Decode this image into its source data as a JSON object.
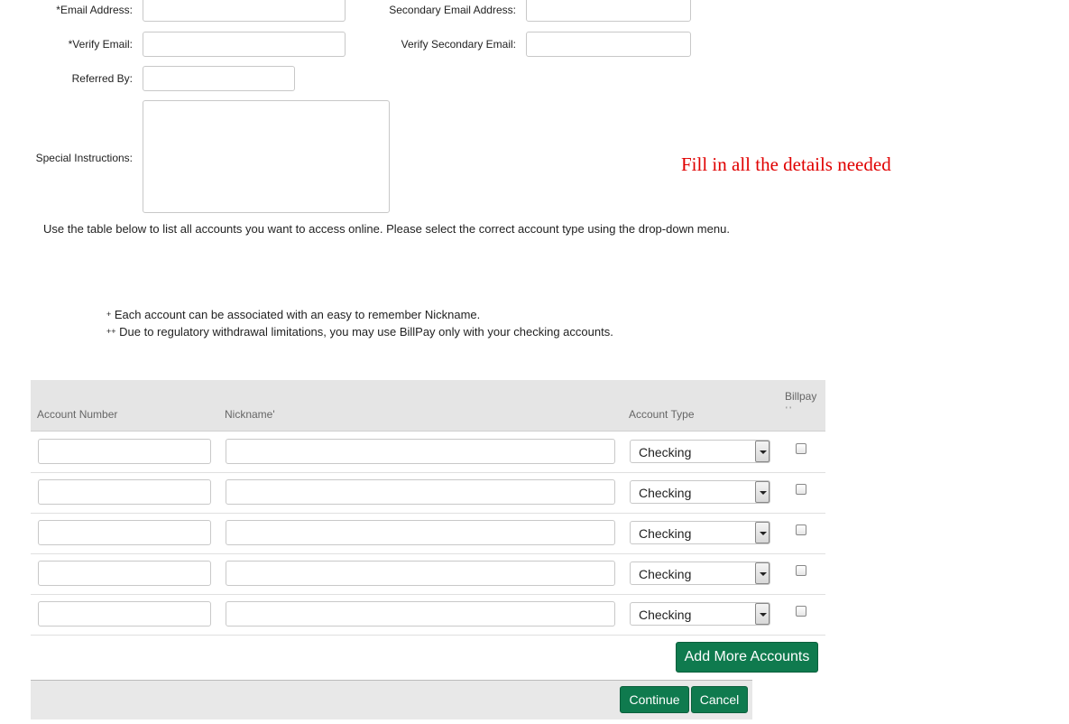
{
  "form": {
    "email_label": "*Email Address:",
    "verify_email_label": "*Verify Email:",
    "referred_by_label": "Referred By:",
    "special_instructions_label": "Special Instructions:",
    "secondary_email_label": "Secondary Email Address:",
    "verify_secondary_email_label": "Verify Secondary Email:"
  },
  "annotation": "Fill in all the details needed",
  "instructions": "Use the table below to list all accounts you want to access online. Please select the correct account type using the drop-down menu.",
  "footnotes": {
    "nickname_mark": "+",
    "nickname_text": " Each account can be associated with an easy to remember Nickname.",
    "billpay_mark": "++",
    "billpay_text": " Due to regulatory withdrawal limitations, you may use BillPay only with your checking accounts."
  },
  "table": {
    "headers": {
      "account_number": "Account Number",
      "nickname": "Nickname'",
      "account_type": "Account Type",
      "billpay": "Billpay",
      "billpay_mark": "' '"
    },
    "rows": [
      {
        "account_type": "Checking",
        "billpay_checked": false
      },
      {
        "account_type": "Checking",
        "billpay_checked": false
      },
      {
        "account_type": "Checking",
        "billpay_checked": false
      },
      {
        "account_type": "Checking",
        "billpay_checked": false
      },
      {
        "account_type": "Checking",
        "billpay_checked": false
      }
    ]
  },
  "buttons": {
    "add_more": "Add More Accounts",
    "continue": "Continue",
    "cancel": "Cancel"
  },
  "colors": {
    "button_green": "#0f7a4e",
    "annotation_red": "#e00000"
  }
}
